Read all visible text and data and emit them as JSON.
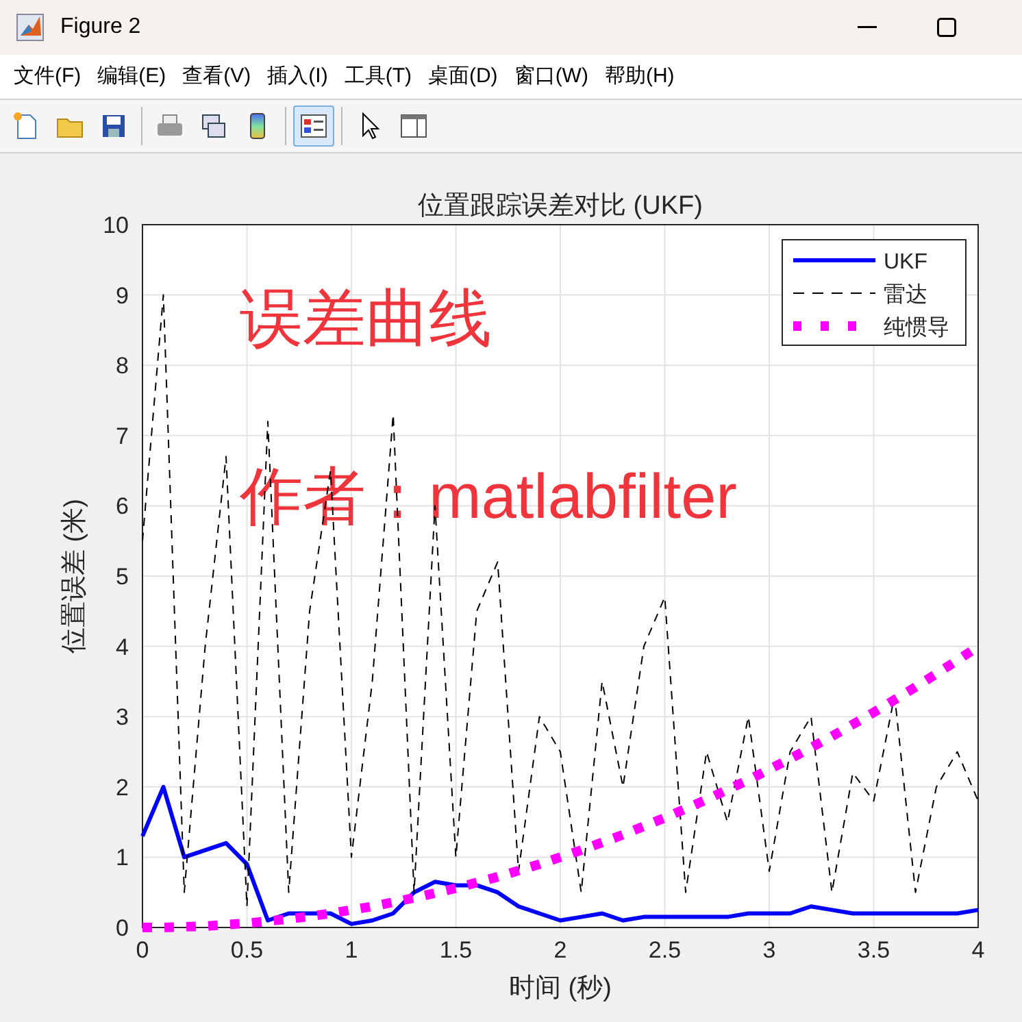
{
  "window": {
    "title": "Figure 2"
  },
  "menu": [
    "文件(F)",
    "编辑(E)",
    "查看(V)",
    "插入(I)",
    "工具(T)",
    "桌面(D)",
    "窗口(W)",
    "帮助(H)"
  ],
  "toolbar": [
    {
      "kind": "new",
      "pressed": false
    },
    {
      "kind": "open",
      "pressed": false
    },
    {
      "kind": "save",
      "pressed": false
    },
    {
      "kind": "print",
      "pressed": false
    },
    {
      "kind": "link",
      "pressed": false
    },
    {
      "kind": "colorbar",
      "pressed": false
    },
    {
      "kind": "legend",
      "pressed": true
    },
    {
      "kind": "pointer",
      "pressed": false
    },
    {
      "kind": "panel",
      "pressed": false
    }
  ],
  "chart_data": {
    "type": "line",
    "title": "位置跟踪误差对比 (UKF)",
    "xlabel": "时间 (秒)",
    "ylabel": "位置误差 (米)",
    "x": [
      0,
      0.1,
      0.2,
      0.3,
      0.4,
      0.5,
      0.6,
      0.7,
      0.8,
      0.9,
      1.0,
      1.1,
      1.2,
      1.3,
      1.4,
      1.5,
      1.6,
      1.7,
      1.8,
      1.9,
      2.0,
      2.1,
      2.2,
      2.3,
      2.4,
      2.5,
      2.6,
      2.7,
      2.8,
      2.9,
      3.0,
      3.1,
      3.2,
      3.3,
      3.4,
      3.5,
      3.6,
      3.7,
      3.8,
      3.9,
      4.0
    ],
    "series": [
      {
        "name": "UKF",
        "color": "#0000ff",
        "line_style": "solid",
        "values": [
          1.3,
          2.0,
          1.0,
          1.1,
          1.2,
          0.9,
          0.1,
          0.2,
          0.2,
          0.2,
          0.05,
          0.1,
          0.2,
          0.5,
          0.65,
          0.6,
          0.6,
          0.5,
          0.3,
          0.2,
          0.1,
          0.15,
          0.2,
          0.1,
          0.15,
          0.15,
          0.15,
          0.15,
          0.15,
          0.2,
          0.2,
          0.2,
          0.3,
          0.25,
          0.2,
          0.2,
          0.2,
          0.2,
          0.2,
          0.2,
          0.25
        ]
      },
      {
        "name": "雷达",
        "color": "#000000",
        "line_style": "dashed",
        "values": [
          5.5,
          9.0,
          0.5,
          4.0,
          6.7,
          0.3,
          7.2,
          0.5,
          4.5,
          6.5,
          1.0,
          3.5,
          7.3,
          0.5,
          6.0,
          1.0,
          4.5,
          5.2,
          0.8,
          3.0,
          2.5,
          0.5,
          3.5,
          2.0,
          4.0,
          4.7,
          0.5,
          2.5,
          1.5,
          3.0,
          0.8,
          2.5,
          3.0,
          0.5,
          2.2,
          1.8,
          3.3,
          0.5,
          2.0,
          2.5,
          1.8
        ]
      },
      {
        "name": "纯惯导",
        "color": "#ff00ff",
        "line_style": "dotted",
        "values": [
          0,
          0,
          0.01,
          0.02,
          0.04,
          0.06,
          0.09,
          0.12,
          0.16,
          0.2,
          0.25,
          0.3,
          0.36,
          0.42,
          0.49,
          0.56,
          0.64,
          0.72,
          0.81,
          0.9,
          1.0,
          1.1,
          1.21,
          1.32,
          1.44,
          1.56,
          1.69,
          1.82,
          1.96,
          2.1,
          2.25,
          2.4,
          2.56,
          2.72,
          2.89,
          3.06,
          3.24,
          3.42,
          3.61,
          3.8,
          4.0
        ]
      }
    ],
    "grid": true,
    "legend": true,
    "xlim": [
      0,
      4
    ],
    "ylim": [
      0,
      10
    ],
    "xticks": [
      {
        "value": 0,
        "label": "0"
      },
      {
        "value": 0.5,
        "label": "0.5"
      },
      {
        "value": 1,
        "label": "1"
      },
      {
        "value": 1.5,
        "label": "1.5"
      },
      {
        "value": 2,
        "label": "2"
      },
      {
        "value": 2.5,
        "label": "2.5"
      },
      {
        "value": 3,
        "label": "3"
      },
      {
        "value": 3.5,
        "label": "3.5"
      },
      {
        "value": 4,
        "label": "4"
      }
    ],
    "yticks": [
      0,
      1,
      2,
      3,
      4,
      5,
      6,
      7,
      8,
      9,
      10
    ],
    "annotations": [
      {
        "text": "误差曲线"
      },
      {
        "text": "作者：matlabfilter"
      }
    ]
  }
}
